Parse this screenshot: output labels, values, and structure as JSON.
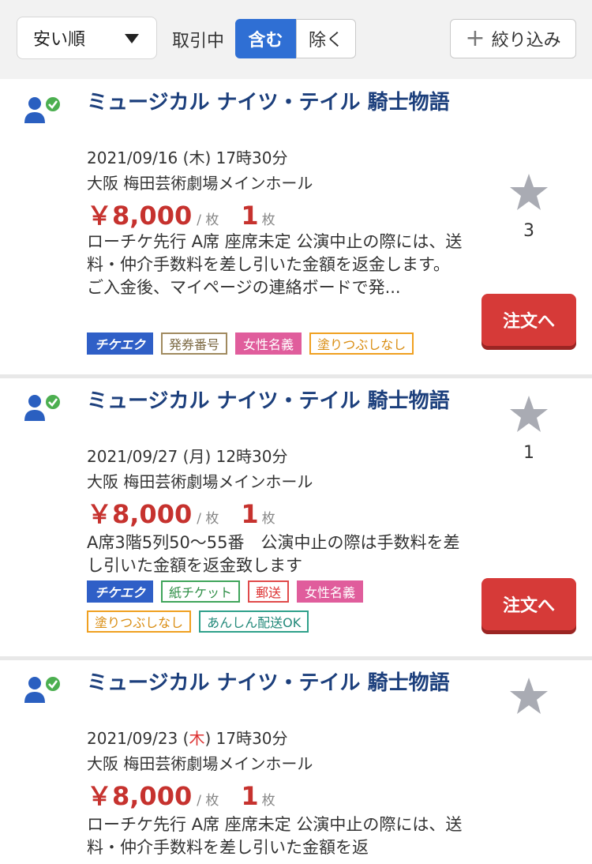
{
  "filters": {
    "sort_label": "安い順",
    "trade_label": "取引中",
    "include_label": "含む",
    "exclude_label": "除く",
    "narrow_label": "絞り込み"
  },
  "listings": [
    {
      "title": "ミュージカル ナイツ・テイル 騎士物語",
      "date": "2021/09/16",
      "dow": "(木)",
      "time": "17時30分",
      "venue": "大阪 梅田芸術劇場メインホール",
      "price": "￥8,000",
      "per": "/ 枚",
      "qty": "1",
      "qty_unit": "枚",
      "desc": "ローチケ先行 A席 座席未定 公演中止の際には、送料・仲介手数料を差し引いた金額を返金します。\nご入金後、マイページの連絡ボードで発...",
      "tags": [
        "チケエク",
        "発券番号",
        "女性名義",
        "塗りつぶしなし"
      ],
      "fav_count": "3",
      "order_label": "注文へ"
    },
    {
      "title": "ミュージカル ナイツ・テイル 騎士物語",
      "date": "2021/09/27",
      "dow": "(月)",
      "time": "12時30分",
      "venue": "大阪 梅田芸術劇場メインホール",
      "price": "￥8,000",
      "per": "/ 枚",
      "qty": "1",
      "qty_unit": "枚",
      "desc": "A席3階5列50〜55番　公演中止の際は手数料を差し引いた金額を返金致します",
      "tags": [
        "チケエク",
        "紙チケット",
        "郵送",
        "女性名義",
        "塗りつぶしなし",
        "あんしん配送OK"
      ],
      "fav_count": "1",
      "order_label": "注文へ"
    },
    {
      "title": "ミュージカル ナイツ・テイル 騎士物語",
      "date": "2021/09/23",
      "dow_open": "(",
      "dow_day": "木",
      "dow_close": ")",
      "time": "17時30分",
      "venue": "大阪 梅田芸術劇場メインホール",
      "price": "￥8,000",
      "per": "/ 枚",
      "qty": "1",
      "qty_unit": "枚",
      "desc": "ローチケ先行 A席 座席未定 公演中止の際には、送料・仲介手数料を差し引いた金額を返"
    }
  ],
  "colors": {
    "accent_blue": "#2f6fd4",
    "title_navy": "#1c3f7c",
    "price_red": "#c6322e",
    "order_red": "#d63a38"
  }
}
